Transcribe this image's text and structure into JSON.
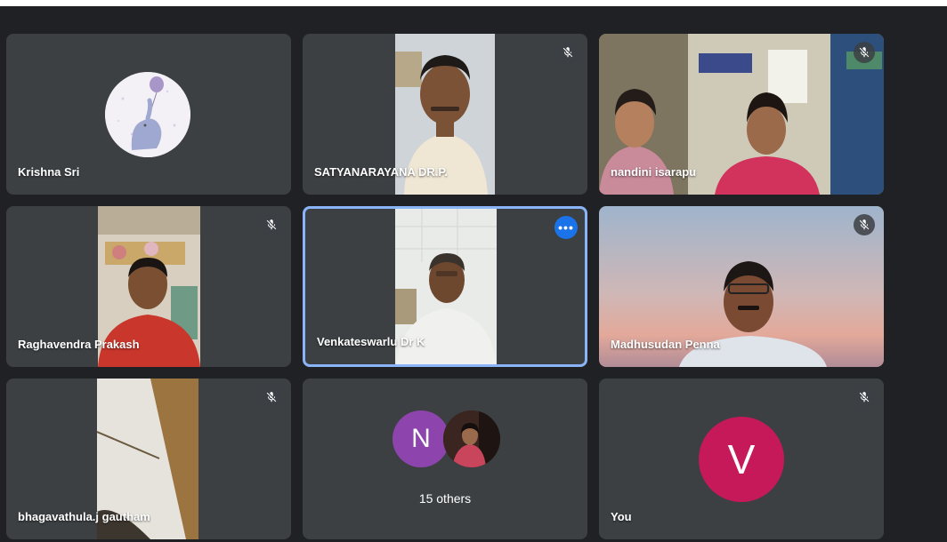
{
  "participants": [
    {
      "name": "Krishna Sri",
      "muted": false
    },
    {
      "name": "SATYANARAYANA DR.P.",
      "muted": true
    },
    {
      "name": "nandini isarapu",
      "muted": true
    },
    {
      "name": "Raghavendra Prakash",
      "muted": true
    },
    {
      "name": "Venkateswarlu Dr K",
      "muted": false,
      "active_speaker": true
    },
    {
      "name": "Madhusudan Penna",
      "muted": true
    },
    {
      "name": "bhagavathula.j gautham",
      "muted": true
    },
    {
      "name": "You",
      "muted": true,
      "avatar_letter": "V",
      "avatar_color": "#c5195a"
    }
  ],
  "others": {
    "label": "15 others",
    "avatar_letter": "N",
    "avatar_color": "#8e44ad"
  },
  "icons": {
    "mute": "mic-off-icon",
    "more": "more-options-icon"
  },
  "colors": {
    "background": "#202124",
    "tile": "#3c4043",
    "active_border": "#8ab4f8",
    "accent": "#1a73e8"
  }
}
